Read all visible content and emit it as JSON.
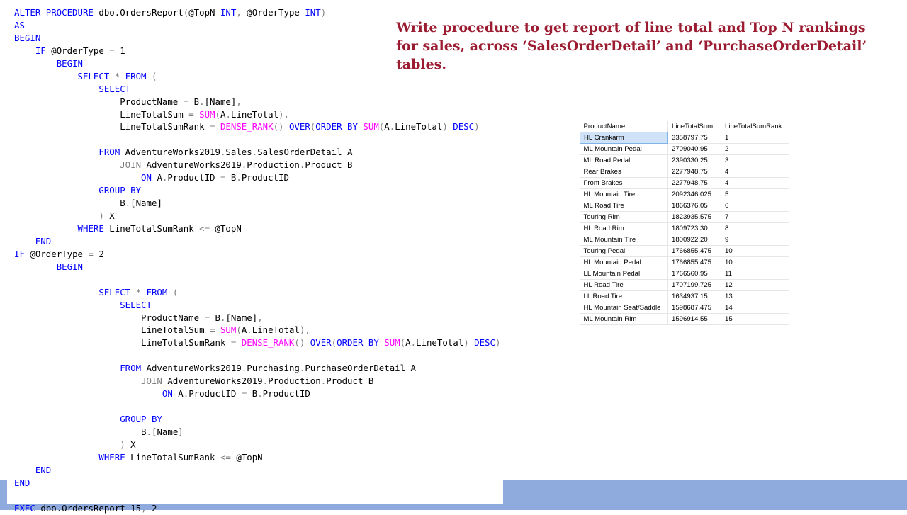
{
  "code": {
    "lines": [
      [
        {
          "t": "ALTER PROCEDURE ",
          "c": "kw"
        },
        {
          "t": "dbo.OrdersReport",
          "c": ""
        },
        {
          "t": "(",
          "c": "op"
        },
        {
          "t": "@TopN ",
          "c": ""
        },
        {
          "t": "INT",
          "c": "kw"
        },
        {
          "t": ", ",
          "c": "op"
        },
        {
          "t": "@OrderType ",
          "c": ""
        },
        {
          "t": "INT",
          "c": "kw"
        },
        {
          "t": ")",
          "c": "op"
        }
      ],
      [
        {
          "t": "AS",
          "c": "kw"
        }
      ],
      [
        {
          "t": "BEGIN",
          "c": "kw"
        }
      ],
      [
        {
          "t": "    ",
          "c": ""
        },
        {
          "t": "IF ",
          "c": "kw"
        },
        {
          "t": "@OrderType ",
          "c": ""
        },
        {
          "t": "= ",
          "c": "op"
        },
        {
          "t": "1",
          "c": ""
        }
      ],
      [
        {
          "t": "        ",
          "c": ""
        },
        {
          "t": "BEGIN",
          "c": "kw"
        }
      ],
      [
        {
          "t": "            ",
          "c": ""
        },
        {
          "t": "SELECT ",
          "c": "kw"
        },
        {
          "t": "* ",
          "c": "op"
        },
        {
          "t": "FROM ",
          "c": "kw"
        },
        {
          "t": "(",
          "c": "op"
        }
      ],
      [
        {
          "t": "                ",
          "c": ""
        },
        {
          "t": "SELECT",
          "c": "kw"
        }
      ],
      [
        {
          "t": "                    ",
          "c": ""
        },
        {
          "t": "ProductName ",
          "c": ""
        },
        {
          "t": "= ",
          "c": "op"
        },
        {
          "t": "B",
          "c": ""
        },
        {
          "t": ".",
          "c": "op"
        },
        {
          "t": "[Name]",
          "c": ""
        },
        {
          "t": ",",
          "c": "op"
        }
      ],
      [
        {
          "t": "                    ",
          "c": ""
        },
        {
          "t": "LineTotalSum ",
          "c": ""
        },
        {
          "t": "= ",
          "c": "op"
        },
        {
          "t": "SUM",
          "c": "fn"
        },
        {
          "t": "(",
          "c": "op"
        },
        {
          "t": "A",
          "c": ""
        },
        {
          "t": ".",
          "c": "op"
        },
        {
          "t": "LineTotal",
          "c": ""
        },
        {
          "t": "),",
          "c": "op"
        }
      ],
      [
        {
          "t": "                    ",
          "c": ""
        },
        {
          "t": "LineTotalSumRank ",
          "c": ""
        },
        {
          "t": "= ",
          "c": "op"
        },
        {
          "t": "DENSE_RANK",
          "c": "fn"
        },
        {
          "t": "() ",
          "c": "op"
        },
        {
          "t": "OVER",
          "c": "kw"
        },
        {
          "t": "(",
          "c": "op"
        },
        {
          "t": "ORDER BY ",
          "c": "kw"
        },
        {
          "t": "SUM",
          "c": "fn"
        },
        {
          "t": "(",
          "c": "op"
        },
        {
          "t": "A",
          "c": ""
        },
        {
          "t": ".",
          "c": "op"
        },
        {
          "t": "LineTotal",
          "c": ""
        },
        {
          "t": ") ",
          "c": "op"
        },
        {
          "t": "DESC",
          "c": "kw"
        },
        {
          "t": ")",
          "c": "op"
        }
      ],
      [],
      [
        {
          "t": "                ",
          "c": ""
        },
        {
          "t": "FROM ",
          "c": "kw"
        },
        {
          "t": "AdventureWorks2019",
          "c": ""
        },
        {
          "t": ".",
          "c": "op"
        },
        {
          "t": "Sales",
          "c": ""
        },
        {
          "t": ".",
          "c": "op"
        },
        {
          "t": "SalesOrderDetail A",
          "c": ""
        }
      ],
      [
        {
          "t": "                    ",
          "c": ""
        },
        {
          "t": "JOIN ",
          "c": "op"
        },
        {
          "t": "AdventureWorks2019",
          "c": ""
        },
        {
          "t": ".",
          "c": "op"
        },
        {
          "t": "Production",
          "c": ""
        },
        {
          "t": ".",
          "c": "op"
        },
        {
          "t": "Product B",
          "c": ""
        }
      ],
      [
        {
          "t": "                        ",
          "c": ""
        },
        {
          "t": "ON ",
          "c": "kw"
        },
        {
          "t": "A",
          "c": ""
        },
        {
          "t": ".",
          "c": "op"
        },
        {
          "t": "ProductID ",
          "c": ""
        },
        {
          "t": "= ",
          "c": "op"
        },
        {
          "t": "B",
          "c": ""
        },
        {
          "t": ".",
          "c": "op"
        },
        {
          "t": "ProductID",
          "c": ""
        }
      ],
      [
        {
          "t": "                ",
          "c": ""
        },
        {
          "t": "GROUP BY",
          "c": "kw"
        }
      ],
      [
        {
          "t": "                    ",
          "c": ""
        },
        {
          "t": "B",
          "c": ""
        },
        {
          "t": ".",
          "c": "op"
        },
        {
          "t": "[Name]",
          "c": ""
        }
      ],
      [
        {
          "t": "                ",
          "c": ""
        },
        {
          "t": ") ",
          "c": "op"
        },
        {
          "t": "X",
          "c": ""
        }
      ],
      [
        {
          "t": "            ",
          "c": ""
        },
        {
          "t": "WHERE ",
          "c": "kw"
        },
        {
          "t": "LineTotalSumRank ",
          "c": ""
        },
        {
          "t": "<= ",
          "c": "op"
        },
        {
          "t": "@TopN",
          "c": ""
        }
      ],
      [
        {
          "t": "    ",
          "c": ""
        },
        {
          "t": "END",
          "c": "kw"
        }
      ],
      [
        {
          "t": "IF ",
          "c": "kw"
        },
        {
          "t": "@OrderType ",
          "c": ""
        },
        {
          "t": "= ",
          "c": "op"
        },
        {
          "t": "2",
          "c": ""
        }
      ],
      [
        {
          "t": "        ",
          "c": ""
        },
        {
          "t": "BEGIN",
          "c": "kw"
        }
      ],
      [],
      [
        {
          "t": "                ",
          "c": ""
        },
        {
          "t": "SELECT ",
          "c": "kw"
        },
        {
          "t": "* ",
          "c": "op"
        },
        {
          "t": "FROM ",
          "c": "kw"
        },
        {
          "t": "(",
          "c": "op"
        }
      ],
      [
        {
          "t": "                    ",
          "c": ""
        },
        {
          "t": "SELECT",
          "c": "kw"
        }
      ],
      [
        {
          "t": "                        ",
          "c": ""
        },
        {
          "t": "ProductName ",
          "c": ""
        },
        {
          "t": "= ",
          "c": "op"
        },
        {
          "t": "B",
          "c": ""
        },
        {
          "t": ".",
          "c": "op"
        },
        {
          "t": "[Name]",
          "c": ""
        },
        {
          "t": ",",
          "c": "op"
        }
      ],
      [
        {
          "t": "                        ",
          "c": ""
        },
        {
          "t": "LineTotalSum ",
          "c": ""
        },
        {
          "t": "= ",
          "c": "op"
        },
        {
          "t": "SUM",
          "c": "fn"
        },
        {
          "t": "(",
          "c": "op"
        },
        {
          "t": "A",
          "c": ""
        },
        {
          "t": ".",
          "c": "op"
        },
        {
          "t": "LineTotal",
          "c": ""
        },
        {
          "t": "),",
          "c": "op"
        }
      ],
      [
        {
          "t": "                        ",
          "c": ""
        },
        {
          "t": "LineTotalSumRank ",
          "c": ""
        },
        {
          "t": "= ",
          "c": "op"
        },
        {
          "t": "DENSE_RANK",
          "c": "fn"
        },
        {
          "t": "() ",
          "c": "op"
        },
        {
          "t": "OVER",
          "c": "kw"
        },
        {
          "t": "(",
          "c": "op"
        },
        {
          "t": "ORDER BY ",
          "c": "kw"
        },
        {
          "t": "SUM",
          "c": "fn"
        },
        {
          "t": "(",
          "c": "op"
        },
        {
          "t": "A",
          "c": ""
        },
        {
          "t": ".",
          "c": "op"
        },
        {
          "t": "LineTotal",
          "c": ""
        },
        {
          "t": ") ",
          "c": "op"
        },
        {
          "t": "DESC",
          "c": "kw"
        },
        {
          "t": ")",
          "c": "op"
        }
      ],
      [],
      [
        {
          "t": "                    ",
          "c": ""
        },
        {
          "t": "FROM ",
          "c": "kw"
        },
        {
          "t": "AdventureWorks2019",
          "c": ""
        },
        {
          "t": ".",
          "c": "op"
        },
        {
          "t": "Purchasing",
          "c": ""
        },
        {
          "t": ".",
          "c": "op"
        },
        {
          "t": "PurchaseOrderDetail A",
          "c": ""
        }
      ],
      [
        {
          "t": "                        ",
          "c": ""
        },
        {
          "t": "JOIN ",
          "c": "op"
        },
        {
          "t": "AdventureWorks2019",
          "c": ""
        },
        {
          "t": ".",
          "c": "op"
        },
        {
          "t": "Production",
          "c": ""
        },
        {
          "t": ".",
          "c": "op"
        },
        {
          "t": "Product B",
          "c": ""
        }
      ],
      [
        {
          "t": "                            ",
          "c": ""
        },
        {
          "t": "ON ",
          "c": "kw"
        },
        {
          "t": "A",
          "c": ""
        },
        {
          "t": ".",
          "c": "op"
        },
        {
          "t": "ProductID ",
          "c": ""
        },
        {
          "t": "= ",
          "c": "op"
        },
        {
          "t": "B",
          "c": ""
        },
        {
          "t": ".",
          "c": "op"
        },
        {
          "t": "ProductID",
          "c": ""
        }
      ],
      [],
      [
        {
          "t": "                    ",
          "c": ""
        },
        {
          "t": "GROUP BY",
          "c": "kw"
        }
      ],
      [
        {
          "t": "                        ",
          "c": ""
        },
        {
          "t": "B",
          "c": ""
        },
        {
          "t": ".",
          "c": "op"
        },
        {
          "t": "[Name]",
          "c": ""
        }
      ],
      [
        {
          "t": "                    ",
          "c": ""
        },
        {
          "t": ") ",
          "c": "op"
        },
        {
          "t": "X",
          "c": ""
        }
      ],
      [
        {
          "t": "                ",
          "c": ""
        },
        {
          "t": "WHERE ",
          "c": "kw"
        },
        {
          "t": "LineTotalSumRank ",
          "c": ""
        },
        {
          "t": "<= ",
          "c": "op"
        },
        {
          "t": "@TopN",
          "c": ""
        }
      ],
      [
        {
          "t": "    ",
          "c": ""
        },
        {
          "t": "END",
          "c": "kw"
        }
      ],
      [
        {
          "t": "END",
          "c": "kw"
        }
      ],
      [],
      [
        {
          "t": "EXEC ",
          "c": "kw"
        },
        {
          "t": "dbo.OrdersReport ",
          "c": ""
        },
        {
          "t": "15",
          "c": ""
        },
        {
          "t": ", ",
          "c": "op"
        },
        {
          "t": "2",
          "c": ""
        }
      ]
    ]
  },
  "slide": {
    "title": "Write procedure to get report of line total and Top  N rankings for sales,  across ‘SalesOrderDetail’ and ‘PurchaseOrderDetail’  tables."
  },
  "results": {
    "columns": [
      "ProductName",
      "LineTotalSum",
      "LineTotalSumRank"
    ],
    "rows": [
      [
        "HL Crankarm",
        "3358797.75",
        "1"
      ],
      [
        "ML Mountain Pedal",
        "2709040.95",
        "2"
      ],
      [
        "ML Road Pedal",
        "2390330.25",
        "3"
      ],
      [
        "Rear Brakes",
        "2277948.75",
        "4"
      ],
      [
        "Front Brakes",
        "2277948.75",
        "4"
      ],
      [
        "HL Mountain Tire",
        "2092346.025",
        "5"
      ],
      [
        "ML Road Tire",
        "1866376.05",
        "6"
      ],
      [
        "Touring Rim",
        "1823935.575",
        "7"
      ],
      [
        "HL Road Rim",
        "1809723.30",
        "8"
      ],
      [
        "ML Mountain Tire",
        "1800922.20",
        "9"
      ],
      [
        "Touring Pedal",
        "1766855.475",
        "10"
      ],
      [
        "HL Mountain Pedal",
        "1766855.475",
        "10"
      ],
      [
        "LL Mountain Pedal",
        "1766560.95",
        "11"
      ],
      [
        "HL Road Tire",
        "1707199.725",
        "12"
      ],
      [
        "LL Road Tire",
        "1634937.15",
        "13"
      ],
      [
        "HL Mountain Seat/Saddle",
        "1598687.475",
        "14"
      ],
      [
        "ML Mountain Rim",
        "1596914.55",
        "15"
      ]
    ],
    "selected_row": 0
  }
}
